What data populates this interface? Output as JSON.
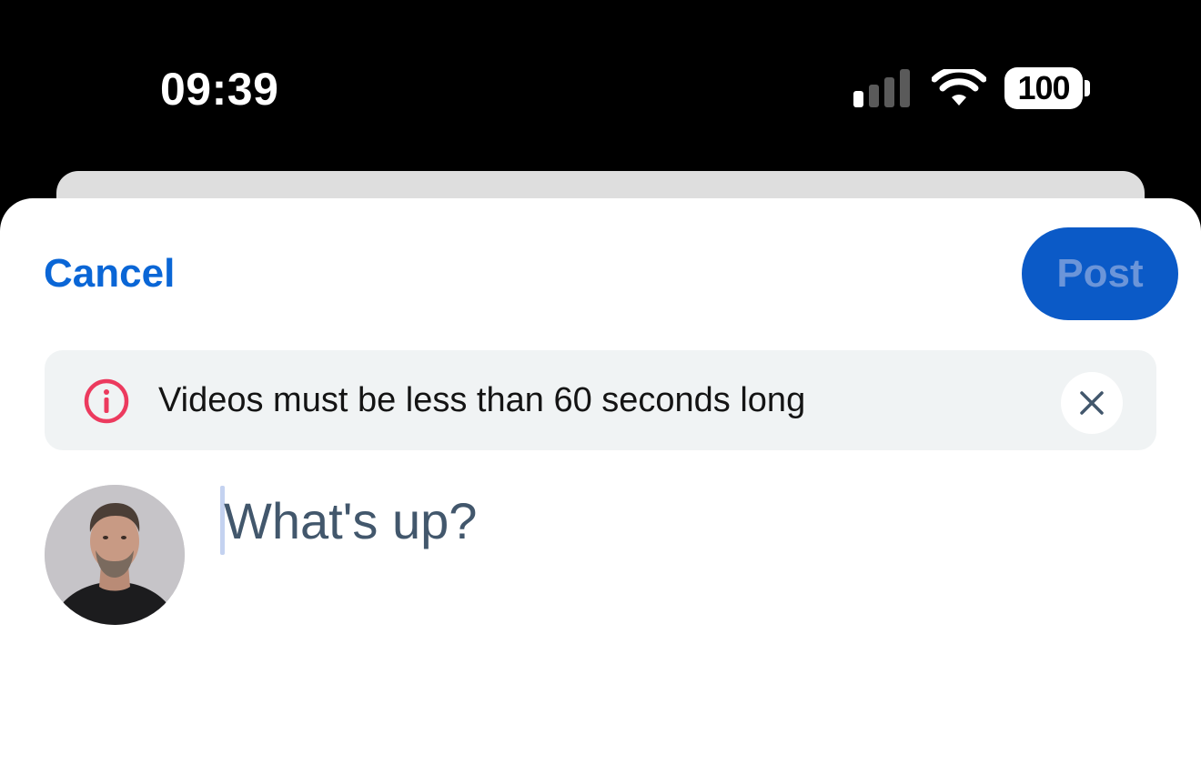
{
  "status_bar": {
    "time": "09:39",
    "battery": "100",
    "signal_icon": "cellular-signal-icon",
    "wifi_icon": "wifi-icon"
  },
  "header": {
    "cancel_label": "Cancel",
    "post_label": "Post"
  },
  "alert": {
    "icon": "info-circle-icon",
    "message": "Videos must be less than 60 seconds long",
    "close_icon": "close-icon"
  },
  "composer": {
    "placeholder": "What's up?",
    "value": ""
  },
  "colors": {
    "accent": "#0a66d6",
    "post_button_bg": "#0b5ac7",
    "alert_icon": "#ec3a5e",
    "alert_bg": "#f0f3f4"
  }
}
